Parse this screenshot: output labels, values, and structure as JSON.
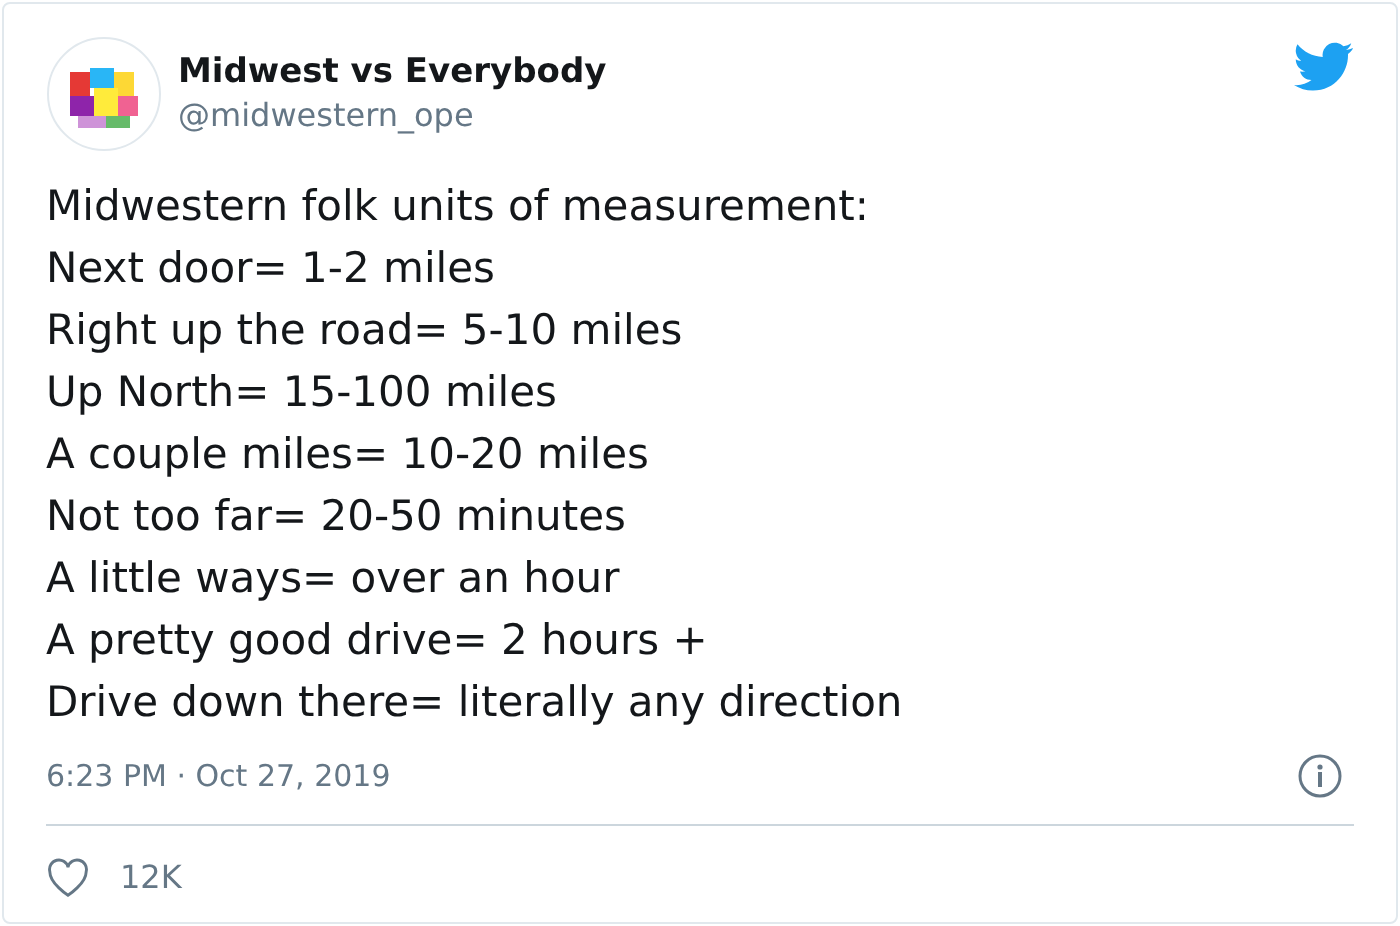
{
  "author": {
    "name": "Midwest vs Everybody",
    "handle": "@midwestern_ope"
  },
  "tweet": {
    "lines": [
      "Midwestern folk units of measurement:",
      "Next door= 1-2 miles",
      "Right up the road= 5-10 miles",
      "Up North= 15-100 miles",
      "A couple miles= 10-20 miles",
      "Not too far= 20-50 minutes",
      "A little ways= over an hour",
      "A pretty good drive= 2 hours +",
      "Drive down there= literally any direction"
    ]
  },
  "timestamp": "6:23 PM · Oct 27, 2019",
  "likes": {
    "count": "12K",
    "liked": false
  }
}
